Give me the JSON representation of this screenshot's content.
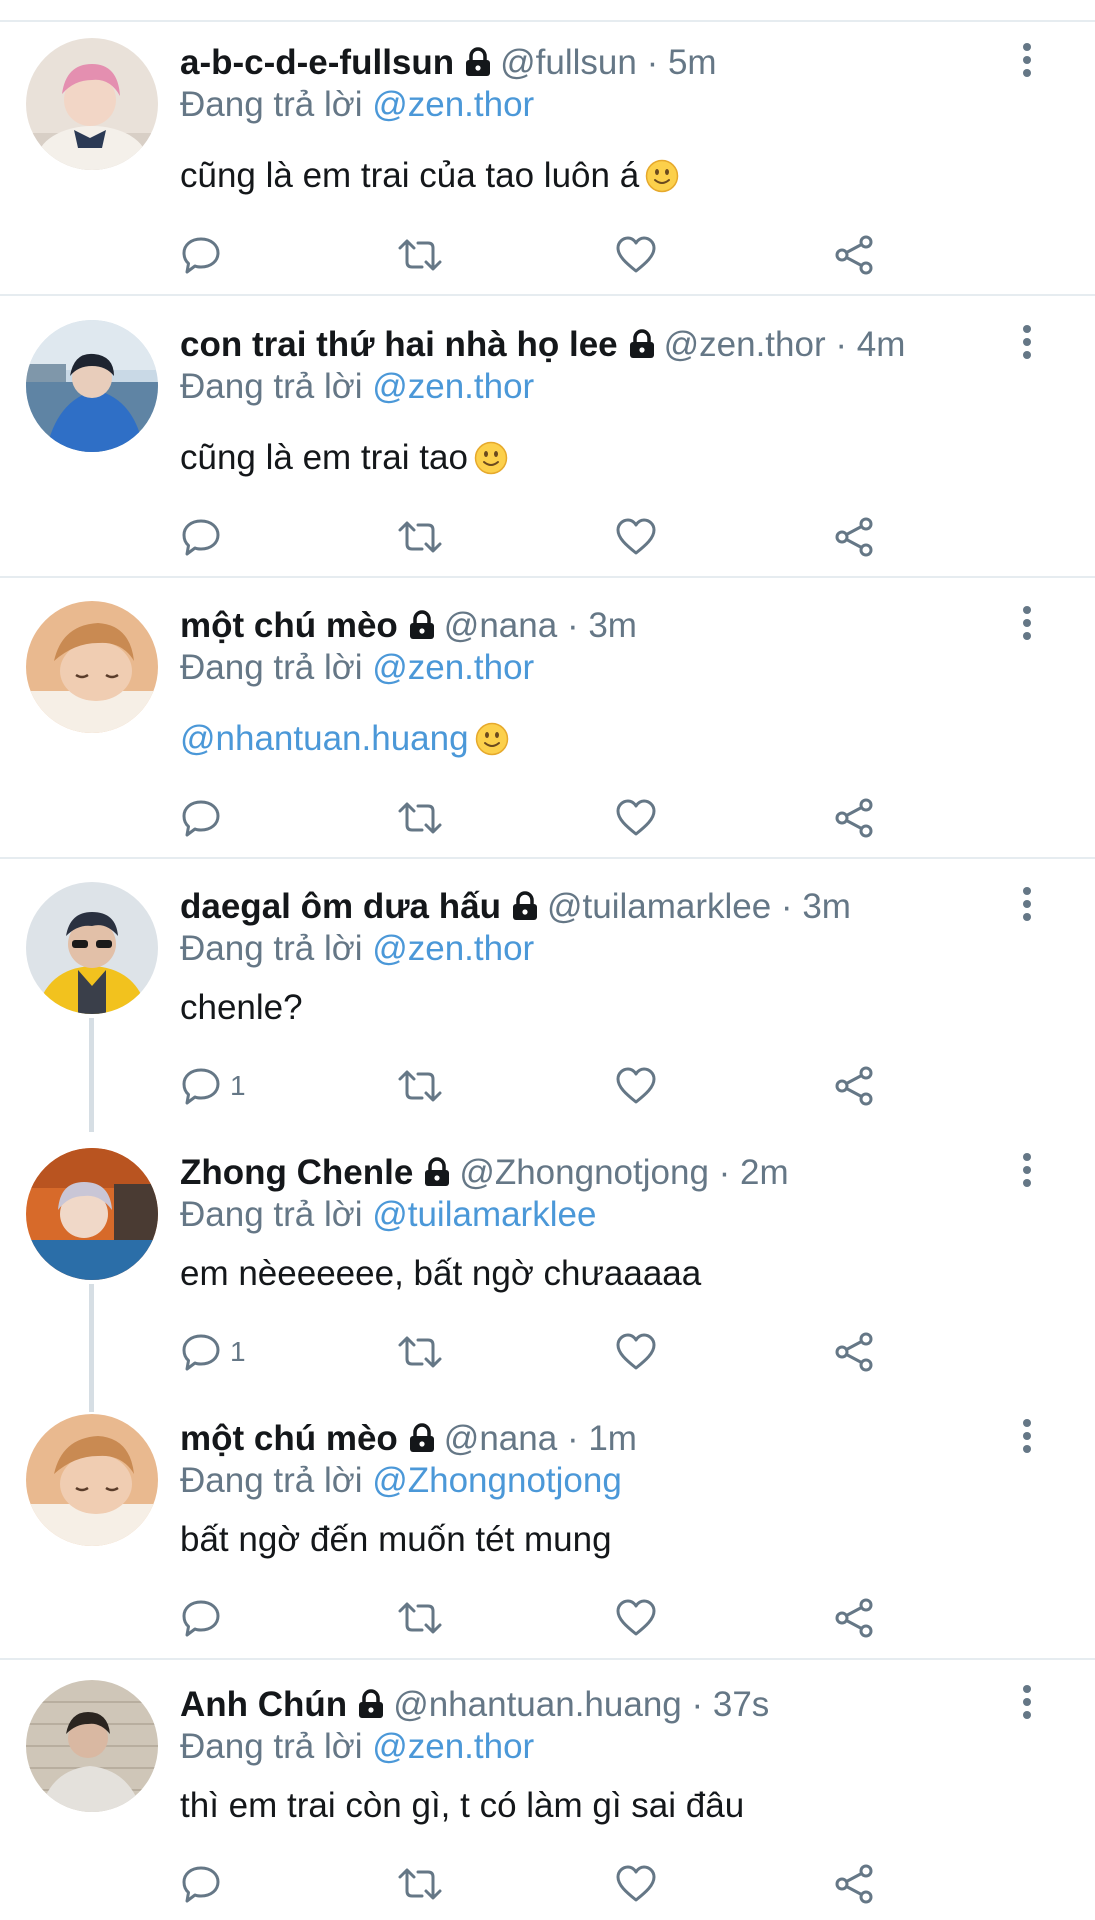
{
  "reply_prefix": "Đang trả lời",
  "tweets": [
    {
      "name": "a-b-c-d-e-fullsun",
      "handle": "@fullsun",
      "sep": "·",
      "time": "5m",
      "reply_to": "@zen.thor",
      "text": "cũng là em trai của tao luôn á",
      "text_mention": "",
      "reply_count": "",
      "emoji": "slightly-smiling-face",
      "avatar": "pink-hair-boy"
    },
    {
      "name": "con trai thứ hai nhà họ lee",
      "handle": "@zen.thor",
      "sep": "·",
      "time": "4m",
      "reply_to": "@zen.thor",
      "text": "cũng là em trai tao",
      "text_mention": "",
      "reply_count": "",
      "emoji": "slightly-smiling-face",
      "avatar": "boy-by-sea"
    },
    {
      "name": "một chú mèo",
      "handle": "@nana",
      "sep": "·",
      "time": "3m",
      "reply_to": "@zen.thor",
      "text": "",
      "text_mention": "@nhantuan.huang",
      "reply_count": "",
      "emoji": "slightly-smiling-face",
      "avatar": "sleepy-boy"
    },
    {
      "name": "daegal ôm dưa hấu",
      "handle": "@tuilamarklee",
      "sep": "·",
      "time": "3m",
      "reply_to": "@zen.thor",
      "text": "chenle?",
      "text_mention": "",
      "reply_count": "1",
      "emoji": "",
      "avatar": "bandana-boy"
    },
    {
      "name": "Zhong Chenle",
      "handle": "@Zhongnotjong",
      "sep": "·",
      "time": "2m",
      "reply_to": "@tuilamarklee",
      "text": "em nèeeeeee, bất ngờ chưaaaaa",
      "text_mention": "",
      "reply_count": "1",
      "emoji": "",
      "avatar": "car-boy"
    },
    {
      "name": "một chú mèo",
      "handle": "@nana",
      "sep": "·",
      "time": "1m",
      "reply_to": "@Zhongnotjong",
      "text": "bất ngờ đến muốn tét mung",
      "text_mention": "",
      "reply_count": "",
      "emoji": "",
      "avatar": "sleepy-boy"
    },
    {
      "name": "Anh Chún",
      "handle": "@nhantuan.huang",
      "sep": "·",
      "time": "37s",
      "reply_to": "@zen.thor",
      "text": "thì em trai còn gì, t có làm gì sai đâu",
      "text_mention": "",
      "reply_count": "",
      "emoji": "",
      "avatar": "sweater-boy"
    }
  ],
  "icons": {
    "reply": "speech-bubble-icon",
    "retweet": "retweet-icon",
    "like": "heart-icon",
    "share": "share-icon",
    "more": "vertical-dots-icon",
    "lock": "lock-icon"
  },
  "colors": {
    "link": "#4b98d8",
    "muted": "#657786",
    "text": "#14171a",
    "divider": "#e6ecf0"
  }
}
